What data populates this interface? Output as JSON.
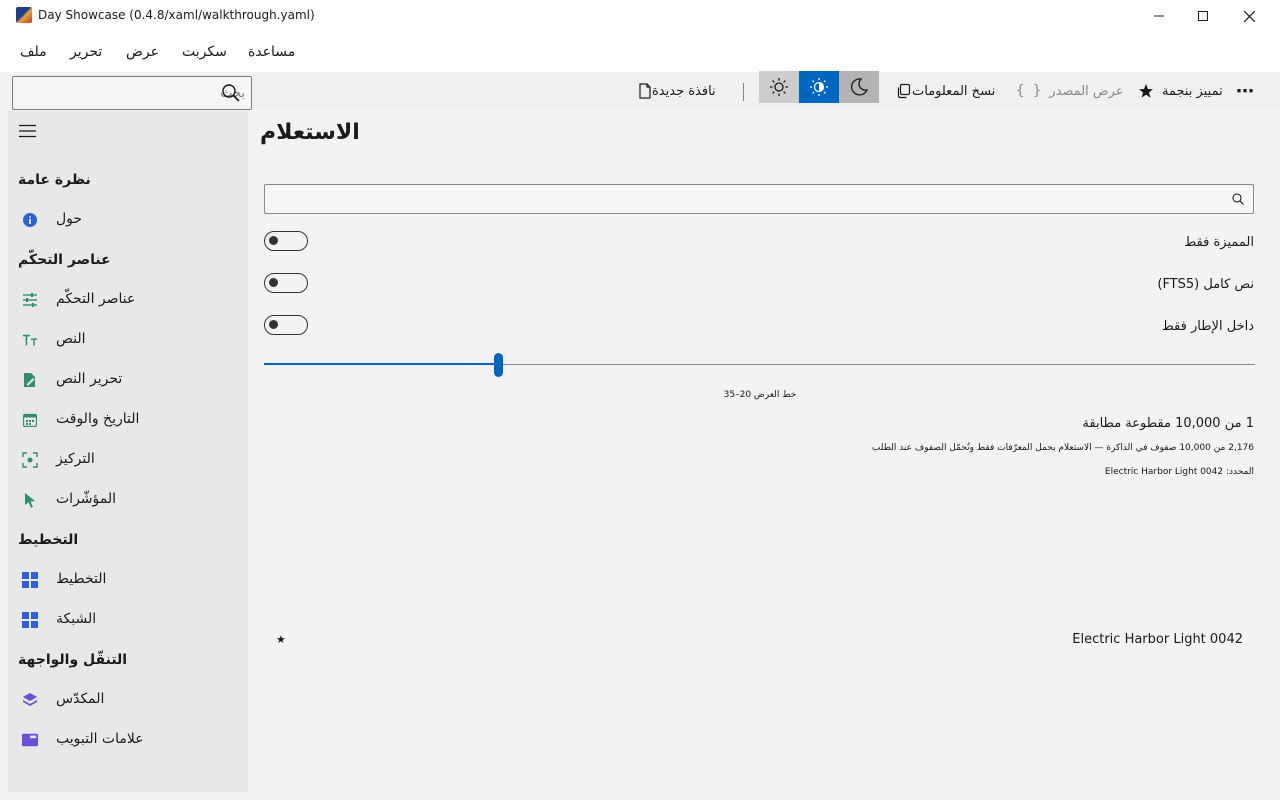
{
  "window": {
    "title": "Day Showcase (0.4.8/xaml/walkthrough.yaml)",
    "minimize": "—",
    "maximize": "☐",
    "close": "✕"
  },
  "menu": {
    "file": "ملف",
    "edit": "تحرير",
    "view": "عرض",
    "script": "سكربت",
    "help": "مساعدة"
  },
  "search": {
    "placeholder": "بحث"
  },
  "toolbar": {
    "new_window": "نافذة جديدة",
    "copy_info": "نسخ المعلومات",
    "view_source": "عرض المصدر",
    "star_highlight": "تمييز بنجمة",
    "more": "⋯"
  },
  "sidebar": {
    "sections": {
      "overview": "نظرة عامة",
      "controls": "عناصر التحكّم",
      "layout": "التخطيط",
      "navigation": "التنقّل والواجهة"
    },
    "items": {
      "about": "حول",
      "controls": "عناصر التحكّم",
      "text": "النص",
      "text_editing": "تحرير النص",
      "date_time": "التاريخ والوقت",
      "focus": "التركيز",
      "pointers": "المؤشّرات",
      "layout": "التخطيط",
      "grid": "الشبكة",
      "stack": "المكدّس",
      "tabs": "علامات التبويب"
    }
  },
  "main": {
    "title": "الاستعلام",
    "query": {
      "value": "",
      "placeholder": ""
    },
    "toggles": {
      "starred_only": "المميزة فقط",
      "full_text": "نص كامل (FTS5)",
      "in_frame_only": "داخل الإطار فقط"
    },
    "slider": {
      "caption": "خط العرض 20–35",
      "position_fraction": 0.236
    },
    "match_count": "1 من 10,000 مقطوعة مطابقة",
    "memory_note": "2,176 من 10,000 صفوف في الذاكرة — الاستعلام يحمل المعرّفات فقط وتُحمّل الصفوف عند الطلب",
    "selected_line": "المحدد: Electric Harbor Light 0042",
    "results": [
      {
        "name": "Electric Harbor Light 0042",
        "star": "★"
      }
    ]
  },
  "colors": {
    "accent": "#0067c0",
    "sidebar_bg": "#e8e8e8",
    "page_bg": "#f3f3f3"
  }
}
